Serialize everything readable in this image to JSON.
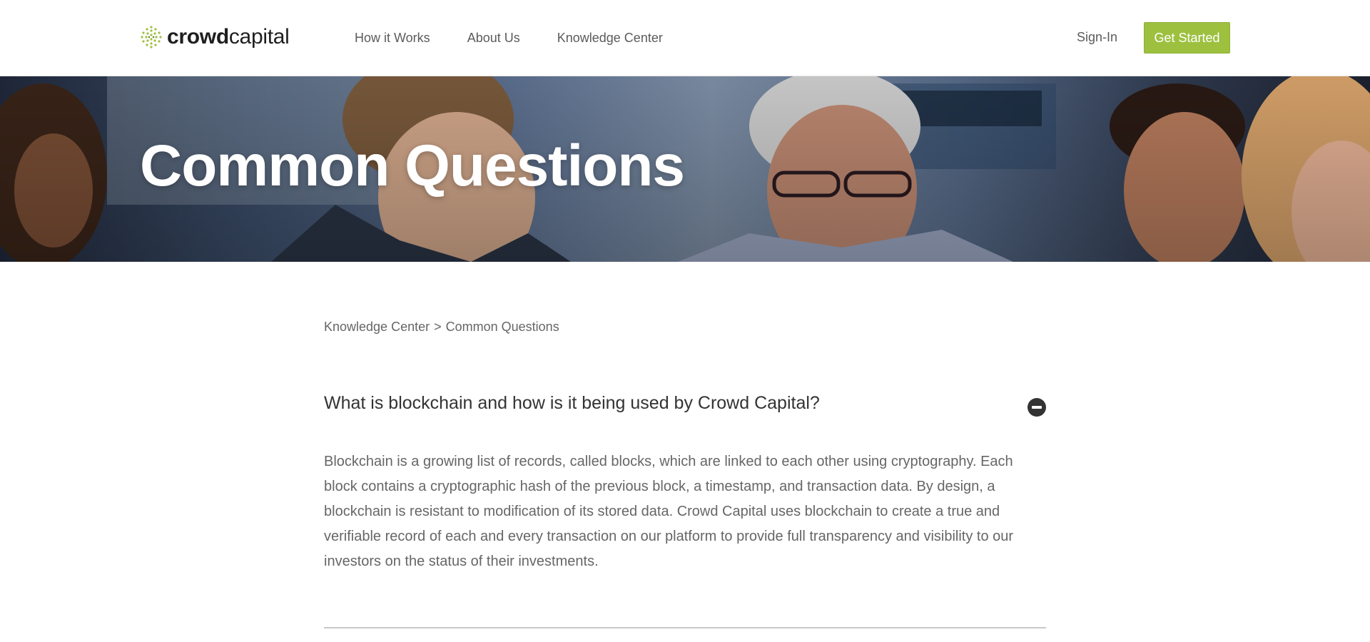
{
  "header": {
    "logo": {
      "icon": "crowdcapital-logo-icon",
      "text_bold": "crowd",
      "text_light": "capital"
    },
    "nav": [
      {
        "label": "How it Works"
      },
      {
        "label": "About Us"
      },
      {
        "label": "Knowledge Center"
      }
    ],
    "signin_label": "Sign-In",
    "cta_label": "Get Started"
  },
  "hero": {
    "title": "Common Questions",
    "image": "people-meeting-photo"
  },
  "breadcrumb": {
    "parent": "Knowledge Center",
    "separator": ">",
    "current": "Common Questions"
  },
  "faq": {
    "question": "What is blockchain and how is it being used by Crowd Capital?",
    "answer": "Blockchain is a growing list of records, called blocks, which are linked to each other using cryptography. Each block contains a cryptographic hash of the previous block, a timestamp, and transaction data. By design, a blockchain is resistant to modification of its stored data. Crowd Capital uses blockchain to create a true and verifiable record of each and every transaction on our platform to provide full transparency and visibility to our investors on the status of their investments.",
    "toggle_icon": "minus-circle-icon"
  },
  "colors": {
    "accent": "#9dc03f",
    "text_dark": "#333333",
    "text_muted": "#666666"
  }
}
